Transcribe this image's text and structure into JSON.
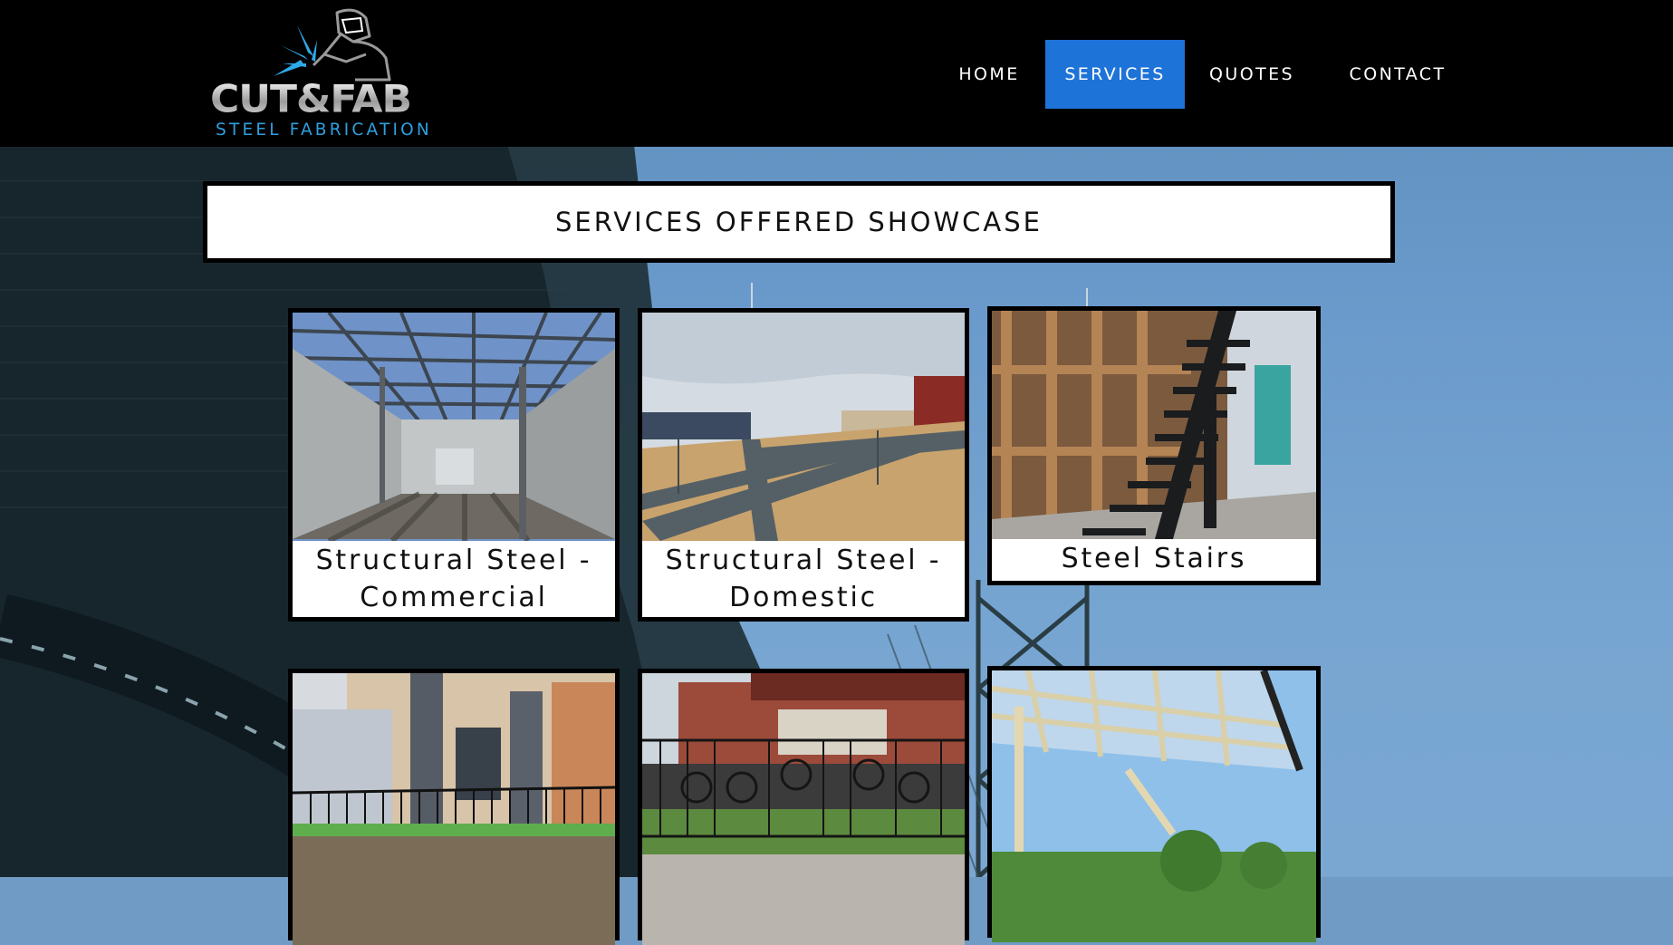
{
  "brand": {
    "name": "CUT&FAB",
    "tagline": "STEEL FABRICATION"
  },
  "nav": {
    "items": [
      {
        "label": "HOME",
        "active": false
      },
      {
        "label": "SERVICES",
        "active": true
      },
      {
        "label": "QUOTES",
        "active": false
      },
      {
        "label": "CONTACT",
        "active": false
      }
    ]
  },
  "colors": {
    "header_bg": "#000000",
    "nav_active": "#1e73d8",
    "tagline": "#2e9fe0",
    "card_border": "#000000",
    "panel_bg": "#ffffff"
  },
  "showcase": {
    "title": "SERVICES OFFERED SHOWCASE",
    "cards": [
      {
        "caption_line1": "Structural Steel -",
        "caption_line2": "Commercial",
        "image": "commercial-steel-structure-photo"
      },
      {
        "caption_line1": "Structural Steel -",
        "caption_line2": "Domestic",
        "image": "domestic-steel-beams-photo"
      },
      {
        "caption_line1": "Steel Stairs",
        "caption_line2": "",
        "image": "steel-stairs-photo"
      },
      {
        "caption_line1": "",
        "caption_line2": "",
        "image": "balustrade-fence-photo"
      },
      {
        "caption_line1": "",
        "caption_line2": "",
        "image": "wrought-iron-gate-photo"
      },
      {
        "caption_line1": "",
        "caption_line2": "",
        "image": "pergola-verandah-photo"
      }
    ]
  }
}
